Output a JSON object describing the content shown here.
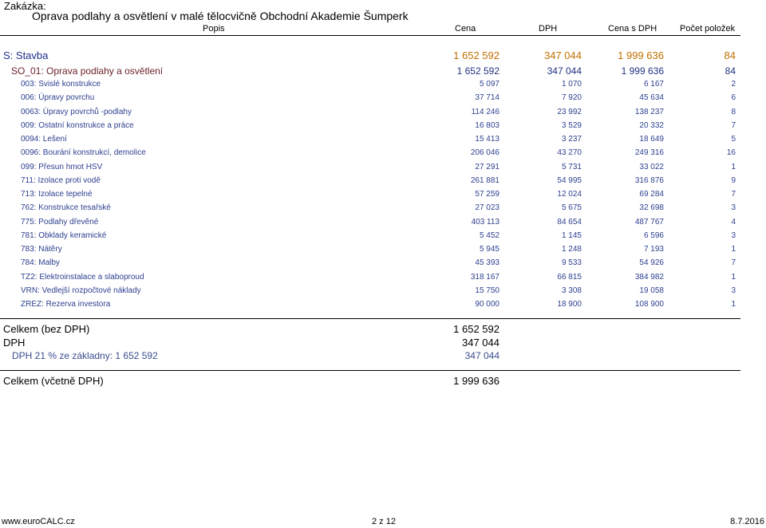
{
  "header": {
    "zakazka_label": "Zakázka:",
    "title": "Oprava podlahy a osvětlení v malé tělocvičně Obchodní Akademie Šumperk",
    "columns": {
      "popis": "Popis",
      "cena": "Cena",
      "dph": "DPH",
      "cena_s_dph": "Cena s DPH",
      "pocet": "Počet položek"
    }
  },
  "stavba": {
    "name": "S: Stavba",
    "cena": "1 652 592",
    "dph": "347 044",
    "cena_s_dph": "1 999 636",
    "pocet": "84"
  },
  "so": {
    "name": "SO_01: Oprava podlahy a osvětlení",
    "cena": "1 652 592",
    "dph": "347 044",
    "cena_s_dph": "1 999 636",
    "pocet": "84"
  },
  "items": [
    {
      "name": "003: Svislé konstrukce",
      "cena": "5 097",
      "dph": "1 070",
      "cena_s_dph": "6 167",
      "pocet": "2"
    },
    {
      "name": "006: Úpravy povrchu",
      "cena": "37 714",
      "dph": "7 920",
      "cena_s_dph": "45 634",
      "pocet": "6"
    },
    {
      "name": "0063: Úpravy povrchů -podlahy",
      "cena": "114 246",
      "dph": "23 992",
      "cena_s_dph": "138 237",
      "pocet": "8"
    },
    {
      "name": "009: Ostatní konstrukce a práce",
      "cena": "16 803",
      "dph": "3 529",
      "cena_s_dph": "20 332",
      "pocet": "7"
    },
    {
      "name": "0094: Lešení",
      "cena": "15 413",
      "dph": "3 237",
      "cena_s_dph": "18 649",
      "pocet": "5"
    },
    {
      "name": "0096: Bourání konstrukcí, demolice",
      "cena": "206 046",
      "dph": "43 270",
      "cena_s_dph": "249 316",
      "pocet": "16"
    },
    {
      "name": "099: Přesun hmot HSV",
      "cena": "27 291",
      "dph": "5 731",
      "cena_s_dph": "33 022",
      "pocet": "1"
    },
    {
      "name": "711: Izolace proti vodě",
      "cena": "261 881",
      "dph": "54 995",
      "cena_s_dph": "316 876",
      "pocet": "9"
    },
    {
      "name": "713: Izolace tepelné",
      "cena": "57 259",
      "dph": "12 024",
      "cena_s_dph": "69 284",
      "pocet": "7"
    },
    {
      "name": "762: Konstrukce tesařské",
      "cena": "27 023",
      "dph": "5 675",
      "cena_s_dph": "32 698",
      "pocet": "3"
    },
    {
      "name": "775: Podlahy dřevěné",
      "cena": "403 113",
      "dph": "84 654",
      "cena_s_dph": "487 767",
      "pocet": "4"
    },
    {
      "name": "781: Obklady keramické",
      "cena": "5 452",
      "dph": "1 145",
      "cena_s_dph": "6 596",
      "pocet": "3"
    },
    {
      "name": "783: Nátěry",
      "cena": "5 945",
      "dph": "1 248",
      "cena_s_dph": "7 193",
      "pocet": "1"
    },
    {
      "name": "784: Malby",
      "cena": "45 393",
      "dph": "9 533",
      "cena_s_dph": "54 926",
      "pocet": "7"
    },
    {
      "name": "TZ2: Elektroinstalace a slaboproud",
      "cena": "318 167",
      "dph": "66 815",
      "cena_s_dph": "384 982",
      "pocet": "1"
    },
    {
      "name": "VRN: Vedlejší rozpočtové náklady",
      "cena": "15 750",
      "dph": "3 308",
      "cena_s_dph": "19 058",
      "pocet": "3"
    },
    {
      "name": "ZREZ: Rezerva investora",
      "cena": "90 000",
      "dph": "18 900",
      "cena_s_dph": "108 900",
      "pocet": "1"
    }
  ],
  "summary": {
    "bez_dph_label": "Celkem (bez DPH)",
    "bez_dph_value": "1 652 592",
    "dph_label": "DPH",
    "dph_value": "347 044",
    "dph_sub_label": "DPH 21 % ze základny: 1 652 592",
    "dph_sub_value": "347 044",
    "vcetne_label": "Celkem (včetně DPH)",
    "vcetne_value": "1 999 636"
  },
  "footer": {
    "site": "www.euroCALC.cz",
    "page": "2 z 12",
    "date": "8.7.2016"
  }
}
